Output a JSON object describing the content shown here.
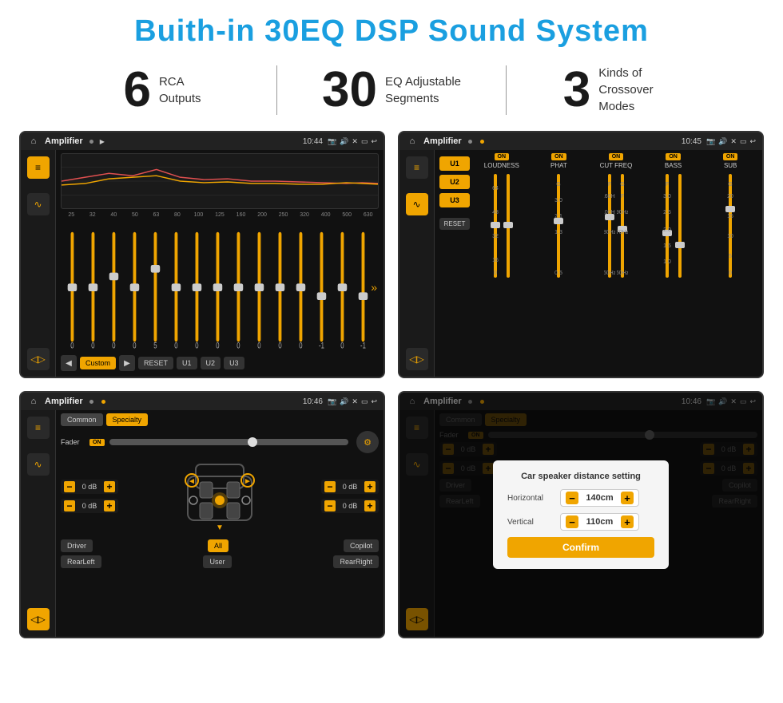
{
  "page": {
    "title": "Buith-in 30EQ DSP Sound System"
  },
  "stats": [
    {
      "number": "6",
      "label": "RCA\nOutputs"
    },
    {
      "number": "30",
      "label": "EQ Adjustable\nSegments"
    },
    {
      "number": "3",
      "label": "Kinds of\nCrossover Modes"
    }
  ],
  "screens": [
    {
      "id": "eq-screen",
      "statusBar": {
        "appName": "Amplifier",
        "time": "10:44"
      },
      "type": "eq"
    },
    {
      "id": "crossover-screen",
      "statusBar": {
        "appName": "Amplifier",
        "time": "10:45"
      },
      "type": "crossover"
    },
    {
      "id": "fader-screen",
      "statusBar": {
        "appName": "Amplifier",
        "time": "10:46"
      },
      "type": "fader"
    },
    {
      "id": "dialog-screen",
      "statusBar": {
        "appName": "Amplifier",
        "time": "10:46"
      },
      "type": "dialog"
    }
  ],
  "eq": {
    "frequencies": [
      "25",
      "32",
      "40",
      "50",
      "63",
      "80",
      "100",
      "125",
      "160",
      "200",
      "250",
      "320",
      "400",
      "500",
      "630"
    ],
    "values": [
      "0",
      "0",
      "0",
      "0",
      "5",
      "0",
      "0",
      "0",
      "0",
      "0",
      "0",
      "0",
      "-1",
      "0",
      "-1"
    ],
    "preset": "Custom",
    "buttons": [
      "RESET",
      "U1",
      "U2",
      "U3"
    ]
  },
  "crossover": {
    "presets": [
      "U1",
      "U2",
      "U3"
    ],
    "columns": [
      {
        "label": "LOUDNESS",
        "on": true
      },
      {
        "label": "PHAT",
        "on": true
      },
      {
        "label": "CUT FREQ",
        "on": true
      },
      {
        "label": "BASS",
        "on": true
      },
      {
        "label": "SUB",
        "on": true
      }
    ],
    "reset": "RESET"
  },
  "fader": {
    "tabs": [
      "Common",
      "Specialty"
    ],
    "activeTab": "Specialty",
    "faderLabel": "Fader",
    "onLabel": "ON",
    "dbValues": [
      "0 dB",
      "0 dB",
      "0 dB",
      "0 dB"
    ],
    "buttons": [
      "Driver",
      "RearLeft",
      "All",
      "Copilot",
      "User",
      "RearRight"
    ]
  },
  "dialog": {
    "title": "Car speaker distance setting",
    "horizontal": {
      "label": "Horizontal",
      "value": "140cm"
    },
    "vertical": {
      "label": "Vertical",
      "value": "110cm"
    },
    "confirmLabel": "Confirm"
  }
}
